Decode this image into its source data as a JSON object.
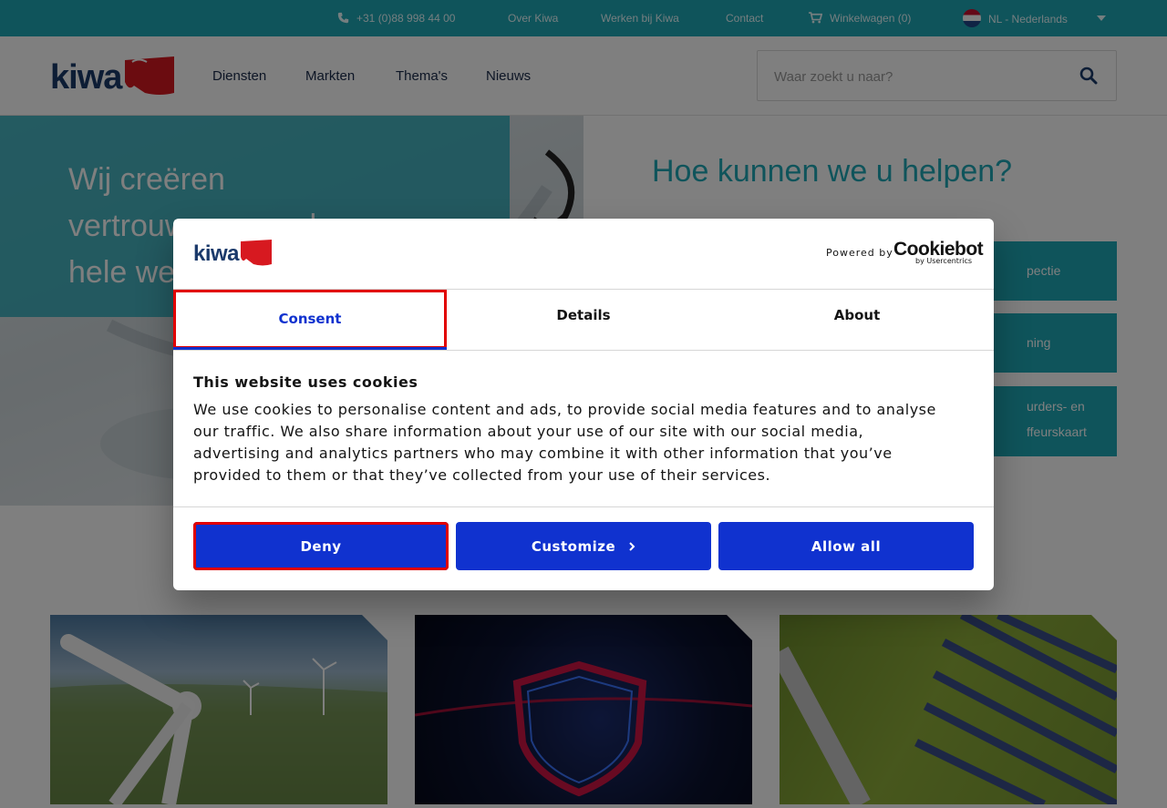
{
  "topbar": {
    "phone": "+31 (0)88 998 44 00",
    "about": "Over Kiwa",
    "jobs": "Werken bij Kiwa",
    "contact": "Contact",
    "cart": "Winkelwagen (0)",
    "language": "NL - Nederlands"
  },
  "header": {
    "nav": [
      "Diensten",
      "Markten",
      "Thema's",
      "Nieuws"
    ],
    "search_placeholder": "Waar zoekt u naar?"
  },
  "hero": {
    "lines": [
      "Wij creëren",
      "vertrouwen over de",
      "hele we"
    ],
    "help_title": "Hoe kunnen we u helpen?",
    "help_buttons": [
      [
        "pectie"
      ],
      [
        "ning"
      ],
      [
        "urders- en",
        "ffeurskaart"
      ]
    ]
  },
  "cookie_dialog": {
    "powered_by": "Powered by",
    "provider": "Cookiebot",
    "provider_sub": "by Usercentrics",
    "tabs": [
      "Consent",
      "Details",
      "About"
    ],
    "heading": "This website uses cookies",
    "body": "We use cookies to personalise content and ads, to provide social media features and to analyse our traffic. We also share information about your use of our site with our social media, advertising and analytics partners who may combine it with other information that you’ve provided to them or that they’ve collected from your use of their services.",
    "buttons": {
      "deny": "Deny",
      "customize": "Customize",
      "allow_all": "Allow all"
    }
  },
  "colors": {
    "brand_teal": "#1fa8b7",
    "dialog_blue": "#1032cf",
    "highlight_red": "#e10000",
    "kiwa_red": "#d71920",
    "kiwa_navy": "#1b3a6b"
  }
}
